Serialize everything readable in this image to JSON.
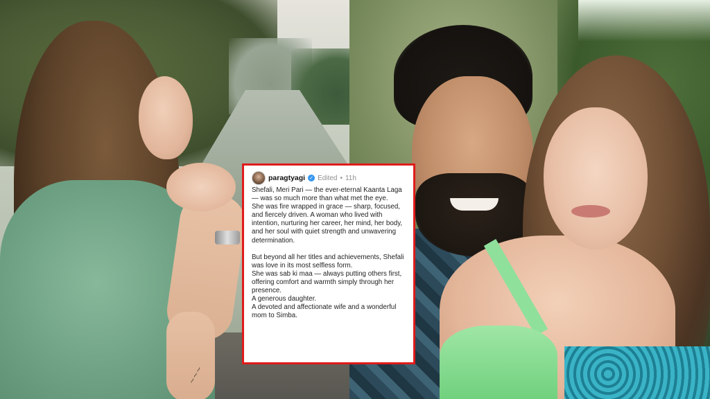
{
  "post": {
    "username": "paragtyagi",
    "edited_label": "Edited",
    "separator": "•",
    "time_ago": "11h",
    "paragraphs": [
      "Shefali, Meri Pari — the ever-eternal Kaanta Laga — was so much more than what met the eye.",
      "She was fire wrapped in grace — sharp, focused, and fiercely driven. A woman who lived with intention, nurturing her career, her mind, her body, and her soul with quiet strength and unwavering determination.",
      "But beyond all her titles and achievements, Shefali was love in its most selfless form.",
      "She was sab ki maa — always putting others first, offering comfort and warmth simply through her presence.",
      "A generous daughter.",
      "A devoted and affectionate wife and a wonderful mom to Simba."
    ]
  },
  "colors": {
    "frame_border": "#e01b1b",
    "verified_badge": "#3897f0"
  },
  "icons": {
    "verified": "verified-badge-icon"
  }
}
